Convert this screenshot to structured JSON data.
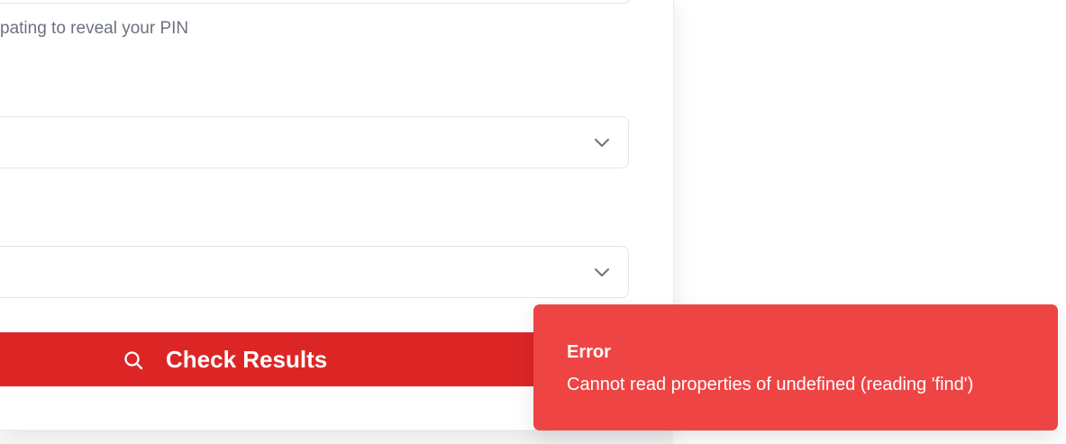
{
  "form": {
    "helper_text": "pating to reveal your PIN",
    "selects": [
      {
        "value": "",
        "icon": "chevron-down-icon"
      },
      {
        "value": "",
        "icon": "chevron-down-icon"
      }
    ],
    "check_button": {
      "label": "Check Results",
      "icon": "search-icon",
      "color": "#dc2626"
    }
  },
  "toast": {
    "title": "Error",
    "message": "Cannot read properties of undefined (reading 'find')",
    "color": "#ef4444"
  }
}
